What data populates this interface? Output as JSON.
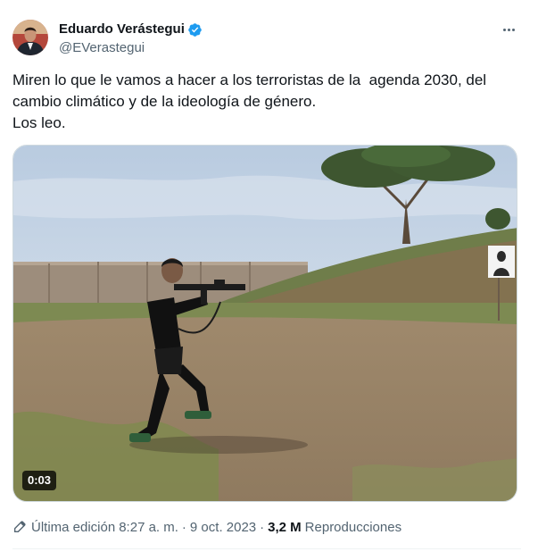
{
  "author": {
    "display_name": "Eduardo Verástegui",
    "handle": "@EVerastegui",
    "verified": true,
    "verified_icon": "verified-badge-icon",
    "verified_color": "#1d9bf0"
  },
  "more_icon": "more-horizontal-icon",
  "tweet": {
    "lines": [
      "Miren lo que le vamos a hacer a los terroristas de la  agenda 2030, del",
      "cambio climático y de la ideología de género.",
      "Los leo."
    ]
  },
  "media": {
    "type": "video",
    "duration": "0:03"
  },
  "meta": {
    "edit_icon": "pencil-icon",
    "edited_label": "Última edición",
    "time": "8:27 a. m.",
    "separator": "·",
    "date": "9 oct. 2023",
    "views_count": "3,2 M",
    "views_label": "Reproducciones"
  },
  "colors": {
    "text_primary": "#0f1419",
    "text_secondary": "#536471",
    "divider": "#eff3f4"
  }
}
